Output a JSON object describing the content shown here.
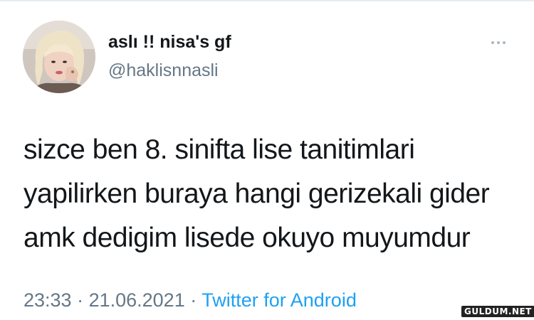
{
  "user": {
    "display_name": "aslı !! nisa's gf",
    "handle": "@haklisnnasli",
    "avatar": "profile-photo"
  },
  "more_icon": "ellipsis-icon",
  "tweet": {
    "lines": [
      "sizce ben 8. sinifta lise tanitimlari",
      "yapilirken buraya hangi gerizekali gider",
      "amk dedigim lisede okuyo muyumdur"
    ]
  },
  "meta": {
    "time": "23:33",
    "separator": " · ",
    "date": "21.06.2021",
    "source": "Twitter for Android"
  },
  "watermark": "GULDUM.NET",
  "colors": {
    "text": "#14171a",
    "secondary": "#657786",
    "link": "#1da1f2"
  }
}
